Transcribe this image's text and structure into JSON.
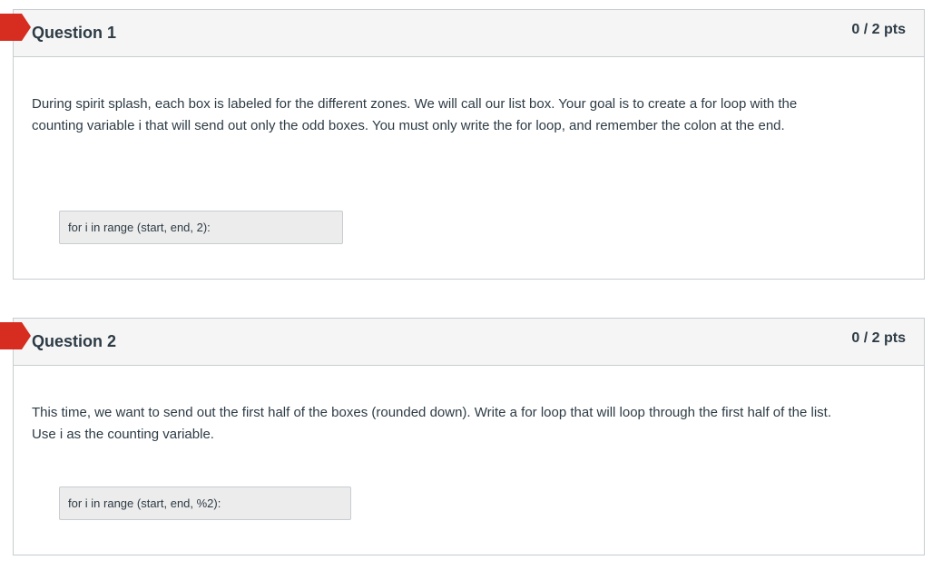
{
  "colors": {
    "flag": "#d62d20",
    "header_bg": "#f5f5f5",
    "border": "#c7cdd1",
    "answer_bg": "#ececec",
    "text": "#2d3b45"
  },
  "questions": [
    {
      "title": "Question 1",
      "points": "0 / 2 pts",
      "text_line1": "During spirit splash, each box is labeled for the different zones.   We will call our list box.  Your goal is to create a for loop with the",
      "text_line2": "counting variable i that will send out only the odd boxes.   You must only write the for loop, and remember the colon at the end.",
      "answer": "for i in range (start, end, 2):",
      "flag_icon": "bookmark-flag-icon"
    },
    {
      "title": "Question 2",
      "points": "0 / 2 pts",
      "text_line1": "This time, we want to send out the first half of the boxes (rounded down).   Write a for loop that will loop through the first half of the list.",
      "text_line2": "Use i as the counting variable.",
      "answer": "for i in range (start, end, %2):",
      "flag_icon": "bookmark-flag-icon"
    }
  ]
}
